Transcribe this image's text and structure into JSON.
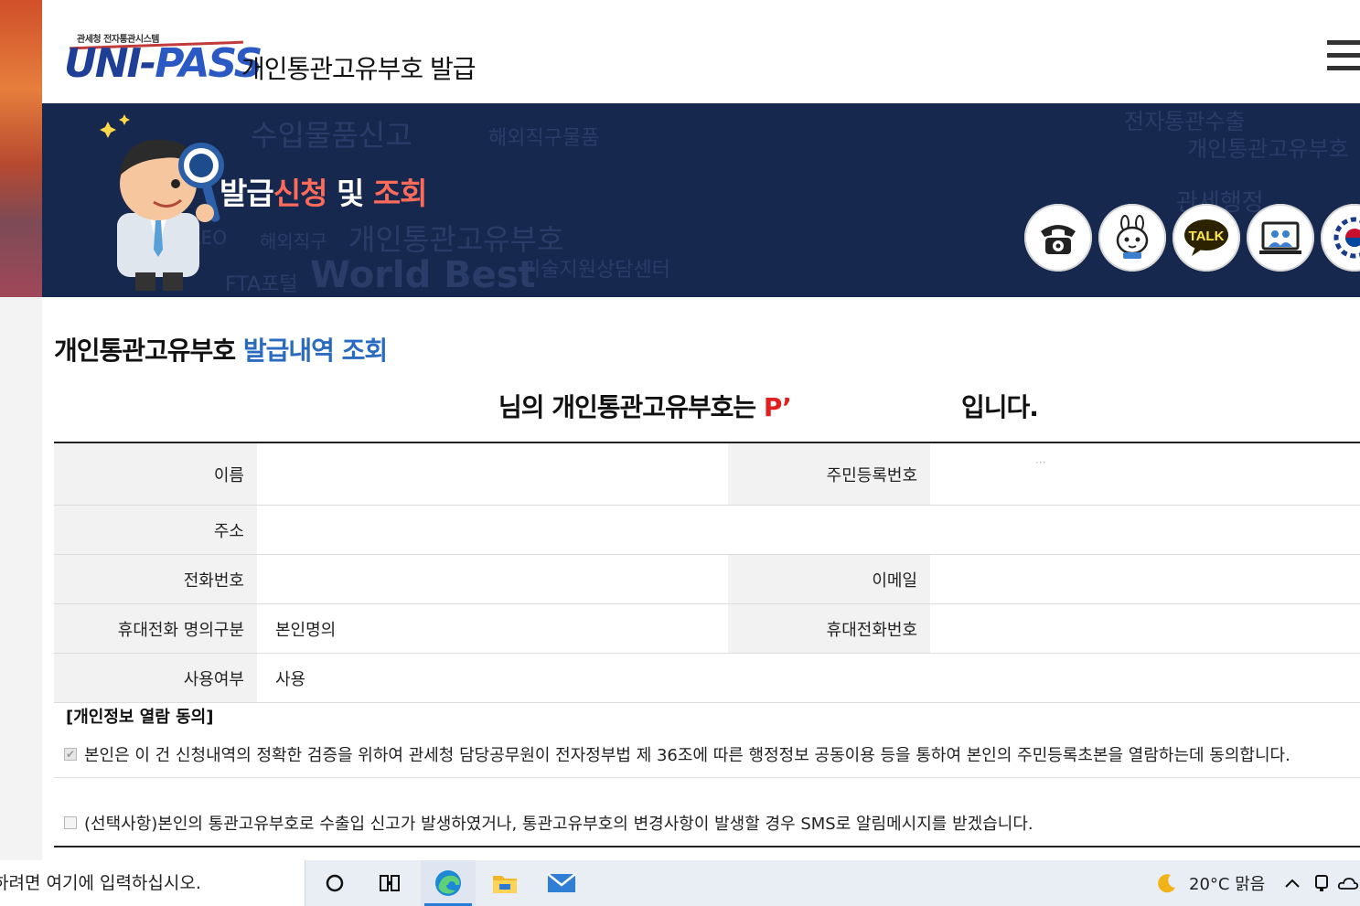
{
  "header": {
    "logo_small": "관세청 전자통관시스템",
    "logo_main_a": "UNI-",
    "logo_main_b": "PASS",
    "title": "개인통관고유부호  발급",
    "menu_icon": "hamburger-menu-icon"
  },
  "banner": {
    "title_a": "발급",
    "title_b": "신청",
    "title_c": " 및 ",
    "title_d": "조회",
    "bg_words": [
      "수입물품신고",
      "해외직구물품",
      "개인통관고유부호",
      "FTA포털",
      "World Best",
      "AEO",
      "해외직구",
      "기술지원상담센터",
      "전자통관수출",
      "개인통관고유부호",
      "관세행정"
    ],
    "quick_icons": [
      "telephone-icon",
      "chatbot-icon",
      "kakao-talk-icon",
      "remote-consult-icon",
      "government-emblem-icon"
    ],
    "talk_label": "TALK"
  },
  "section": {
    "title_a": "개인통관고유부호 ",
    "title_b": "발급내역 조회"
  },
  "message": {
    "prefix": "님의 개인통관고유부호는 ",
    "code": "P’",
    "suffix": "입니다."
  },
  "table": {
    "name_label": "이름",
    "name_value": "",
    "rrn_label": "주민등록번호",
    "rrn_value": "···",
    "address_label": "주소",
    "address_value": "",
    "phone_label": "전화번호",
    "phone_value": "",
    "email_label": "이메일",
    "email_value": "",
    "mobile_type_label": "휴대전화 명의구분",
    "mobile_type_value": "본인명의",
    "mobile_label": "휴대전화번호",
    "mobile_value": "",
    "use_label": "사용여부",
    "use_value": "사용"
  },
  "consent": {
    "heading": "[개인정보 열람 동의]",
    "item1": "본인은 이 건 신청내역의 정확한 검증을 위하여 관세청 담당공무원이 전자정부법 제 36조에 따른 행정정보 공동이용 등을 통하여 본인의 주민등록초본을 열람하는데 동의합니다.",
    "item1_checked": true,
    "item2": "(선택사항)본인의 통관고유부호로 수출입 신고가 발생하였거나, 통관고유부호의 변경사항이 발생할 경우 SMS로 알림메시지를 받겠습니다.",
    "item2_checked": false
  },
  "taskbar": {
    "search_placeholder": "하려면 여기에 입력하십시오.",
    "weather": "20°C  맑음",
    "icons": [
      "cortana-icon",
      "task-view-icon",
      "edge-icon",
      "file-explorer-icon",
      "mail-icon"
    ]
  }
}
